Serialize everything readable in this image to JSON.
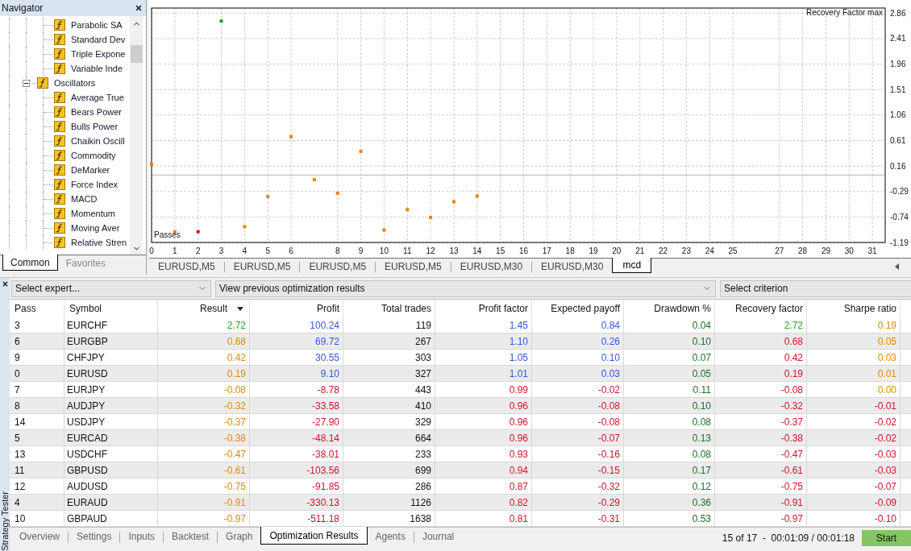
{
  "navigator": {
    "title": "Navigator",
    "tree": [
      {
        "children": [
          {
            "label": "Parabolic SA"
          },
          {
            "label": "Standard Dev"
          },
          {
            "label": "Triple Expone"
          },
          {
            "label": "Variable Inde"
          }
        ]
      },
      {
        "label": "Oscillators",
        "expanded": true,
        "children": [
          {
            "label": "Average True"
          },
          {
            "label": "Bears Power"
          },
          {
            "label": "Bulls Power"
          },
          {
            "label": "Chaikin Oscill"
          },
          {
            "label": "Commodity"
          },
          {
            "label": "DeMarker"
          },
          {
            "label": "Force Index"
          },
          {
            "label": "MACD"
          },
          {
            "label": "Momentum"
          },
          {
            "label": "Moving Aver"
          },
          {
            "label": "Relative Stren"
          }
        ]
      }
    ],
    "tabs": [
      {
        "label": "Common",
        "selected": true
      },
      {
        "label": "Favorites",
        "selected": false
      }
    ]
  },
  "chart": {
    "chart_data": [
      {
        "type": "scatter",
        "xlabel": "Passes",
        "ylabel": "Recovery Factor max",
        "x": [
          0,
          1,
          2,
          3,
          4,
          5,
          6,
          7,
          8,
          9,
          10,
          11,
          12,
          13,
          14
        ],
        "values": [
          0.19,
          -1.0,
          -1.0,
          2.72,
          -0.91,
          -0.38,
          0.68,
          -0.08,
          -0.32,
          0.42,
          -0.97,
          -0.61,
          -0.75,
          -0.47,
          -0.37
        ],
        "colors": [
          "#ee8000",
          "#ee8000",
          "#d41010",
          "#1f9a1f",
          "#ee8000",
          "#ee8000",
          "#ee8000",
          "#ee8000",
          "#ee8000",
          "#ee8000",
          "#ee8000",
          "#ee8000",
          "#ee8000",
          "#ee8000",
          "#ee8000"
        ],
        "marker": "square",
        "grid": true,
        "xlim": [
          0,
          31.55
        ],
        "ylim": [
          -1.19,
          2.95
        ],
        "xticks": [
          0,
          1,
          2,
          3,
          4,
          5,
          6,
          8,
          9,
          10,
          11,
          12,
          13,
          14,
          15,
          16,
          17,
          18,
          19,
          20,
          21,
          22,
          23,
          24,
          25,
          27,
          28,
          29,
          30,
          31
        ],
        "yticks": [
          -1.19,
          -0.74,
          -0.29,
          0.16,
          0.61,
          1.06,
          1.51,
          1.96,
          2.41,
          2.86
        ],
        "ref_lines": [
          {
            "axis": "y",
            "value": 0,
            "color": "#c4c4c4",
            "line_style": "solid"
          }
        ]
      }
    ],
    "tabs": [
      {
        "label": "EURUSD,M5",
        "selected": false
      },
      {
        "label": "EURUSD,M5",
        "selected": false
      },
      {
        "label": "EURUSD,M5",
        "selected": false
      },
      {
        "label": "EURUSD,M5",
        "selected": false
      },
      {
        "label": "EURUSD,M30",
        "selected": false
      },
      {
        "label": "EURUSD,M30",
        "selected": false
      },
      {
        "label": "mcd",
        "selected": true
      }
    ]
  },
  "tester": {
    "title": "Strategy Tester",
    "expert": {
      "value": "Select expert..."
    },
    "results_source": {
      "value": "View previous optimization results"
    },
    "criterion": {
      "value": "Select criterion"
    },
    "table": {
      "columns": [
        {
          "label": "Pass",
          "kind": "text",
          "sorted": false
        },
        {
          "label": "Symbol",
          "kind": "text",
          "sorted": false
        },
        {
          "label": "Result",
          "kind": "number",
          "sorted": true
        },
        {
          "label": "Profit",
          "kind": "number",
          "sorted": false
        },
        {
          "label": "Total trades",
          "kind": "number",
          "sorted": false
        },
        {
          "label": "Profit factor",
          "kind": "number",
          "sorted": false
        },
        {
          "label": "Expected payoff",
          "kind": "number",
          "sorted": false
        },
        {
          "label": "Drawdown %",
          "kind": "number",
          "sorted": false
        },
        {
          "label": "Recovery factor",
          "kind": "number",
          "sorted": false
        },
        {
          "label": "Sharpe ratio",
          "kind": "number",
          "sorted": false
        }
      ],
      "rows": [
        {
          "cells": [
            {
              "text": "3"
            },
            {
              "text": "EURCHF"
            },
            {
              "text": "2.72",
              "color": "#22a722"
            },
            {
              "text": "100.24",
              "color": "#3355e6"
            },
            {
              "text": "119"
            },
            {
              "text": "1.45",
              "color": "#3355e6"
            },
            {
              "text": "0.84",
              "color": "#3355e6"
            },
            {
              "text": "0.04",
              "color": "#1c6e2a"
            },
            {
              "text": "2.72",
              "color": "#22a722"
            },
            {
              "text": "0.19",
              "color": "#e8870a"
            }
          ]
        },
        {
          "cells": [
            {
              "text": "6"
            },
            {
              "text": "EURGBP"
            },
            {
              "text": "0.68",
              "color": "#e8870a"
            },
            {
              "text": "69.72",
              "color": "#3355e6"
            },
            {
              "text": "267"
            },
            {
              "text": "1.10",
              "color": "#3355e6"
            },
            {
              "text": "0.26",
              "color": "#3355e6"
            },
            {
              "text": "0.10",
              "color": "#1c6e2a"
            },
            {
              "text": "0.68",
              "color": "#d3122c"
            },
            {
              "text": "0.05",
              "color": "#e8870a"
            }
          ]
        },
        {
          "cells": [
            {
              "text": "9"
            },
            {
              "text": "CHFJPY"
            },
            {
              "text": "0.42",
              "color": "#e8870a"
            },
            {
              "text": "30.55",
              "color": "#3355e6"
            },
            {
              "text": "303"
            },
            {
              "text": "1.05",
              "color": "#3355e6"
            },
            {
              "text": "0.10",
              "color": "#3355e6"
            },
            {
              "text": "0.07",
              "color": "#1c6e2a"
            },
            {
              "text": "0.42",
              "color": "#d3122c"
            },
            {
              "text": "0.03",
              "color": "#e8870a"
            }
          ]
        },
        {
          "cells": [
            {
              "text": "0"
            },
            {
              "text": "EURUSD"
            },
            {
              "text": "0.19",
              "color": "#e8870a"
            },
            {
              "text": "9.10",
              "color": "#3355e6"
            },
            {
              "text": "327"
            },
            {
              "text": "1.01",
              "color": "#3355e6"
            },
            {
              "text": "0.03",
              "color": "#3355e6"
            },
            {
              "text": "0.05",
              "color": "#1c6e2a"
            },
            {
              "text": "0.19",
              "color": "#d3122c"
            },
            {
              "text": "0.01",
              "color": "#e8870a"
            }
          ]
        },
        {
          "cells": [
            {
              "text": "7"
            },
            {
              "text": "EURJPY"
            },
            {
              "text": "-0.08",
              "color": "#e8870a"
            },
            {
              "text": "-8.78",
              "color": "#d3122c"
            },
            {
              "text": "443"
            },
            {
              "text": "0.99",
              "color": "#d3122c"
            },
            {
              "text": "-0.02",
              "color": "#d3122c"
            },
            {
              "text": "0.11",
              "color": "#1c6e2a"
            },
            {
              "text": "-0.08",
              "color": "#d3122c"
            },
            {
              "text": "0.00",
              "color": "#e8870a"
            }
          ]
        },
        {
          "cells": [
            {
              "text": "8"
            },
            {
              "text": "AUDJPY"
            },
            {
              "text": "-0.32",
              "color": "#e8870a"
            },
            {
              "text": "-33.58",
              "color": "#d3122c"
            },
            {
              "text": "410"
            },
            {
              "text": "0.96",
              "color": "#d3122c"
            },
            {
              "text": "-0.08",
              "color": "#d3122c"
            },
            {
              "text": "0.10",
              "color": "#1c6e2a"
            },
            {
              "text": "-0.32",
              "color": "#d3122c"
            },
            {
              "text": "-0.01",
              "color": "#d3122c"
            }
          ]
        },
        {
          "cells": [
            {
              "text": "14"
            },
            {
              "text": "USDJPY"
            },
            {
              "text": "-0.37",
              "color": "#e8870a"
            },
            {
              "text": "-27.90",
              "color": "#d3122c"
            },
            {
              "text": "329"
            },
            {
              "text": "0.96",
              "color": "#d3122c"
            },
            {
              "text": "-0.08",
              "color": "#d3122c"
            },
            {
              "text": "0.08",
              "color": "#1c6e2a"
            },
            {
              "text": "-0.37",
              "color": "#d3122c"
            },
            {
              "text": "-0.02",
              "color": "#d3122c"
            }
          ]
        },
        {
          "cells": [
            {
              "text": "5"
            },
            {
              "text": "EURCAD"
            },
            {
              "text": "-0.38",
              "color": "#e8870a"
            },
            {
              "text": "-48.14",
              "color": "#d3122c"
            },
            {
              "text": "664"
            },
            {
              "text": "0.96",
              "color": "#d3122c"
            },
            {
              "text": "-0.07",
              "color": "#d3122c"
            },
            {
              "text": "0.13",
              "color": "#1c6e2a"
            },
            {
              "text": "-0.38",
              "color": "#d3122c"
            },
            {
              "text": "-0.02",
              "color": "#d3122c"
            }
          ]
        },
        {
          "cells": [
            {
              "text": "13"
            },
            {
              "text": "USDCHF"
            },
            {
              "text": "-0.47",
              "color": "#e8870a"
            },
            {
              "text": "-38.01",
              "color": "#d3122c"
            },
            {
              "text": "233"
            },
            {
              "text": "0.93",
              "color": "#d3122c"
            },
            {
              "text": "-0.16",
              "color": "#d3122c"
            },
            {
              "text": "0.08",
              "color": "#1c6e2a"
            },
            {
              "text": "-0.47",
              "color": "#d3122c"
            },
            {
              "text": "-0.03",
              "color": "#d3122c"
            }
          ]
        },
        {
          "cells": [
            {
              "text": "11"
            },
            {
              "text": "GBPUSD"
            },
            {
              "text": "-0.61",
              "color": "#e8870a"
            },
            {
              "text": "-103.56",
              "color": "#d3122c"
            },
            {
              "text": "699"
            },
            {
              "text": "0.94",
              "color": "#d3122c"
            },
            {
              "text": "-0.15",
              "color": "#d3122c"
            },
            {
              "text": "0.17",
              "color": "#1c6e2a"
            },
            {
              "text": "-0.61",
              "color": "#d3122c"
            },
            {
              "text": "-0.03",
              "color": "#d3122c"
            }
          ]
        },
        {
          "cells": [
            {
              "text": "12"
            },
            {
              "text": "AUDUSD"
            },
            {
              "text": "-0.75",
              "color": "#e8870a"
            },
            {
              "text": "-91.85",
              "color": "#d3122c"
            },
            {
              "text": "286"
            },
            {
              "text": "0.87",
              "color": "#d3122c"
            },
            {
              "text": "-0.32",
              "color": "#d3122c"
            },
            {
              "text": "0.12",
              "color": "#1c6e2a"
            },
            {
              "text": "-0.75",
              "color": "#d3122c"
            },
            {
              "text": "-0.07",
              "color": "#d3122c"
            }
          ]
        },
        {
          "cells": [
            {
              "text": "4"
            },
            {
              "text": "EURAUD"
            },
            {
              "text": "-0.91",
              "color": "#e8870a"
            },
            {
              "text": "-330.13",
              "color": "#d3122c"
            },
            {
              "text": "1126"
            },
            {
              "text": "0.82",
              "color": "#d3122c"
            },
            {
              "text": "-0.29",
              "color": "#d3122c"
            },
            {
              "text": "0.36",
              "color": "#1c6e2a"
            },
            {
              "text": "-0.91",
              "color": "#d3122c"
            },
            {
              "text": "-0.09",
              "color": "#d3122c"
            }
          ]
        },
        {
          "cells": [
            {
              "text": "10"
            },
            {
              "text": "GBPAUD"
            },
            {
              "text": "-0.97",
              "color": "#e8870a"
            },
            {
              "text": "-511.18",
              "color": "#d3122c"
            },
            {
              "text": "1638"
            },
            {
              "text": "0.81",
              "color": "#d3122c"
            },
            {
              "text": "-0.31",
              "color": "#d3122c"
            },
            {
              "text": "0.53",
              "color": "#1c6e2a"
            },
            {
              "text": "-0.97",
              "color": "#d3122c"
            },
            {
              "text": "-0.10",
              "color": "#d3122c"
            }
          ]
        }
      ]
    },
    "tabs": [
      {
        "label": "Overview",
        "selected": false
      },
      {
        "label": "Settings",
        "selected": false
      },
      {
        "label": "Inputs",
        "selected": false
      },
      {
        "label": "Backtest",
        "selected": false
      },
      {
        "label": "Graph",
        "selected": false
      },
      {
        "label": "Optimization Results",
        "selected": true
      },
      {
        "label": "Agents",
        "selected": false
      },
      {
        "label": "Journal",
        "selected": false
      }
    ],
    "status": "15 of 17  -  00:01:09 / 00:01:18",
    "start_button": {
      "label": "Start"
    }
  }
}
